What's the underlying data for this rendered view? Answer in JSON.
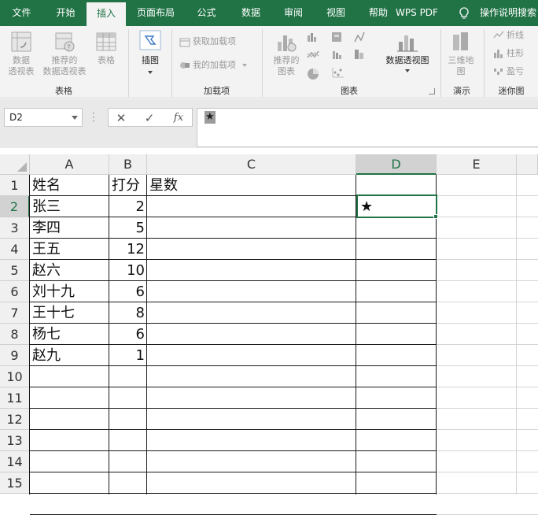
{
  "tabs": [
    {
      "label": "文件",
      "active": false
    },
    {
      "label": "开始",
      "active": false
    },
    {
      "label": "插入",
      "active": true
    },
    {
      "label": "页面布局",
      "active": false
    },
    {
      "label": "公式",
      "active": false
    },
    {
      "label": "数据",
      "active": false
    },
    {
      "label": "审阅",
      "active": false
    },
    {
      "label": "视图",
      "active": false
    },
    {
      "label": "帮助",
      "active": false
    },
    {
      "label": "WPS PDF",
      "active": false
    }
  ],
  "tell_me": "操作说明搜索",
  "ribbon": {
    "tables": {
      "pivot": "数据\n透视表",
      "recommended_pivot": "推荐的\n数据透视表",
      "table": "表格",
      "group_label": "表格"
    },
    "illustrations": {
      "label": "插图"
    },
    "addins": {
      "get_addins": "获取加载项",
      "my_addins": "我的加载项",
      "group_label": "加载项"
    },
    "charts": {
      "recommended": "推荐的\n图表",
      "pivot_chart": "数据透视图",
      "group_label": "图表"
    },
    "tours": {
      "map3d": "三维地\n图",
      "group_label": "演示"
    },
    "sparklines": {
      "line": "折线",
      "column": "柱形",
      "winloss": "盈亏",
      "group_label": "迷你图"
    }
  },
  "formula_bar": {
    "name_box": "D2",
    "cancel": "✕",
    "enter": "✓",
    "fx": "fx",
    "formula": "★"
  },
  "sheet": {
    "columns": [
      "A",
      "B",
      "C",
      "D",
      "E"
    ],
    "selected_column": "D",
    "row_numbers": [
      "1",
      "2",
      "3",
      "4",
      "5",
      "6",
      "7",
      "8",
      "9",
      "10",
      "11",
      "12",
      "13",
      "14",
      "15"
    ],
    "selected_row": "2",
    "header_row": {
      "name": "姓名",
      "score": "打分",
      "stars": "星数"
    },
    "rows": [
      {
        "name": "张三",
        "score": "2"
      },
      {
        "name": "李四",
        "score": "5"
      },
      {
        "name": "王五",
        "score": "12"
      },
      {
        "name": "赵六",
        "score": "10"
      },
      {
        "name": "刘十九",
        "score": "6"
      },
      {
        "name": "王十七",
        "score": "8"
      },
      {
        "name": "杨七",
        "score": "6"
      },
      {
        "name": "赵九",
        "score": "1"
      }
    ],
    "d2_value": "★"
  },
  "colors": {
    "accent": "#217346",
    "ribbon": "#f3f3f3"
  }
}
